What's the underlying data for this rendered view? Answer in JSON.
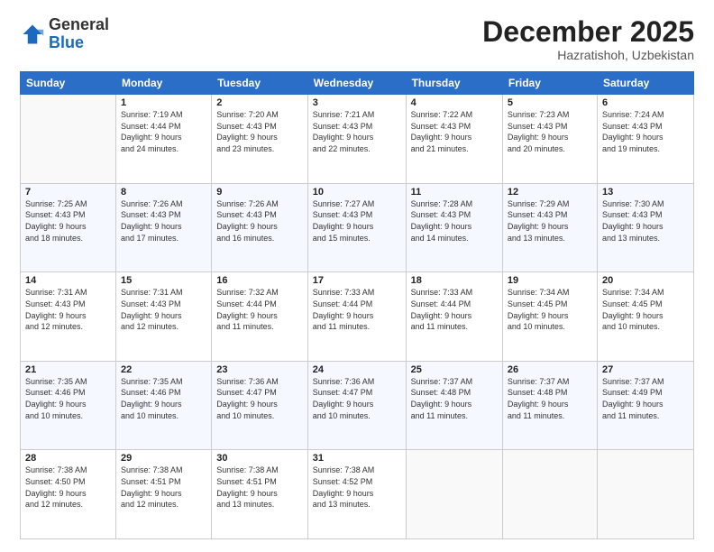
{
  "logo": {
    "general": "General",
    "blue": "Blue"
  },
  "header": {
    "month": "December 2025",
    "location": "Hazratishoh, Uzbekistan"
  },
  "weekdays": [
    "Sunday",
    "Monday",
    "Tuesday",
    "Wednesday",
    "Thursday",
    "Friday",
    "Saturday"
  ],
  "weeks": [
    [
      {
        "day": "",
        "info": ""
      },
      {
        "day": "1",
        "info": "Sunrise: 7:19 AM\nSunset: 4:44 PM\nDaylight: 9 hours\nand 24 minutes."
      },
      {
        "day": "2",
        "info": "Sunrise: 7:20 AM\nSunset: 4:43 PM\nDaylight: 9 hours\nand 23 minutes."
      },
      {
        "day": "3",
        "info": "Sunrise: 7:21 AM\nSunset: 4:43 PM\nDaylight: 9 hours\nand 22 minutes."
      },
      {
        "day": "4",
        "info": "Sunrise: 7:22 AM\nSunset: 4:43 PM\nDaylight: 9 hours\nand 21 minutes."
      },
      {
        "day": "5",
        "info": "Sunrise: 7:23 AM\nSunset: 4:43 PM\nDaylight: 9 hours\nand 20 minutes."
      },
      {
        "day": "6",
        "info": "Sunrise: 7:24 AM\nSunset: 4:43 PM\nDaylight: 9 hours\nand 19 minutes."
      }
    ],
    [
      {
        "day": "7",
        "info": "Sunrise: 7:25 AM\nSunset: 4:43 PM\nDaylight: 9 hours\nand 18 minutes."
      },
      {
        "day": "8",
        "info": "Sunrise: 7:26 AM\nSunset: 4:43 PM\nDaylight: 9 hours\nand 17 minutes."
      },
      {
        "day": "9",
        "info": "Sunrise: 7:26 AM\nSunset: 4:43 PM\nDaylight: 9 hours\nand 16 minutes."
      },
      {
        "day": "10",
        "info": "Sunrise: 7:27 AM\nSunset: 4:43 PM\nDaylight: 9 hours\nand 15 minutes."
      },
      {
        "day": "11",
        "info": "Sunrise: 7:28 AM\nSunset: 4:43 PM\nDaylight: 9 hours\nand 14 minutes."
      },
      {
        "day": "12",
        "info": "Sunrise: 7:29 AM\nSunset: 4:43 PM\nDaylight: 9 hours\nand 13 minutes."
      },
      {
        "day": "13",
        "info": "Sunrise: 7:30 AM\nSunset: 4:43 PM\nDaylight: 9 hours\nand 13 minutes."
      }
    ],
    [
      {
        "day": "14",
        "info": "Sunrise: 7:31 AM\nSunset: 4:43 PM\nDaylight: 9 hours\nand 12 minutes."
      },
      {
        "day": "15",
        "info": "Sunrise: 7:31 AM\nSunset: 4:43 PM\nDaylight: 9 hours\nand 12 minutes."
      },
      {
        "day": "16",
        "info": "Sunrise: 7:32 AM\nSunset: 4:44 PM\nDaylight: 9 hours\nand 11 minutes."
      },
      {
        "day": "17",
        "info": "Sunrise: 7:33 AM\nSunset: 4:44 PM\nDaylight: 9 hours\nand 11 minutes."
      },
      {
        "day": "18",
        "info": "Sunrise: 7:33 AM\nSunset: 4:44 PM\nDaylight: 9 hours\nand 11 minutes."
      },
      {
        "day": "19",
        "info": "Sunrise: 7:34 AM\nSunset: 4:45 PM\nDaylight: 9 hours\nand 10 minutes."
      },
      {
        "day": "20",
        "info": "Sunrise: 7:34 AM\nSunset: 4:45 PM\nDaylight: 9 hours\nand 10 minutes."
      }
    ],
    [
      {
        "day": "21",
        "info": "Sunrise: 7:35 AM\nSunset: 4:46 PM\nDaylight: 9 hours\nand 10 minutes."
      },
      {
        "day": "22",
        "info": "Sunrise: 7:35 AM\nSunset: 4:46 PM\nDaylight: 9 hours\nand 10 minutes."
      },
      {
        "day": "23",
        "info": "Sunrise: 7:36 AM\nSunset: 4:47 PM\nDaylight: 9 hours\nand 10 minutes."
      },
      {
        "day": "24",
        "info": "Sunrise: 7:36 AM\nSunset: 4:47 PM\nDaylight: 9 hours\nand 10 minutes."
      },
      {
        "day": "25",
        "info": "Sunrise: 7:37 AM\nSunset: 4:48 PM\nDaylight: 9 hours\nand 11 minutes."
      },
      {
        "day": "26",
        "info": "Sunrise: 7:37 AM\nSunset: 4:48 PM\nDaylight: 9 hours\nand 11 minutes."
      },
      {
        "day": "27",
        "info": "Sunrise: 7:37 AM\nSunset: 4:49 PM\nDaylight: 9 hours\nand 11 minutes."
      }
    ],
    [
      {
        "day": "28",
        "info": "Sunrise: 7:38 AM\nSunset: 4:50 PM\nDaylight: 9 hours\nand 12 minutes."
      },
      {
        "day": "29",
        "info": "Sunrise: 7:38 AM\nSunset: 4:51 PM\nDaylight: 9 hours\nand 12 minutes."
      },
      {
        "day": "30",
        "info": "Sunrise: 7:38 AM\nSunset: 4:51 PM\nDaylight: 9 hours\nand 13 minutes."
      },
      {
        "day": "31",
        "info": "Sunrise: 7:38 AM\nSunset: 4:52 PM\nDaylight: 9 hours\nand 13 minutes."
      },
      {
        "day": "",
        "info": ""
      },
      {
        "day": "",
        "info": ""
      },
      {
        "day": "",
        "info": ""
      }
    ]
  ]
}
